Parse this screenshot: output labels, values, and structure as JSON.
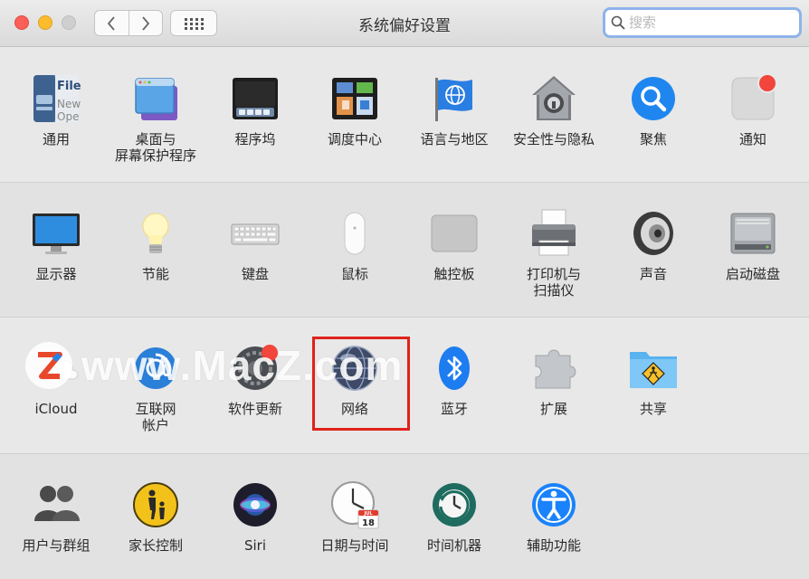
{
  "window": {
    "title": "系统偏好设置"
  },
  "search": {
    "placeholder": "搜索",
    "value": ""
  },
  "rows": [
    {
      "items": [
        {
          "label": "通用",
          "icon": "general-icon"
        },
        {
          "label": "桌面与\n屏幕保护程序",
          "icon": "desktop-screensaver-icon"
        },
        {
          "label": "程序坞",
          "icon": "dock-icon"
        },
        {
          "label": "调度中心",
          "icon": "mission-control-icon"
        },
        {
          "label": "语言与地区",
          "icon": "language-region-icon"
        },
        {
          "label": "安全性与隐私",
          "icon": "security-privacy-icon"
        },
        {
          "label": "聚焦",
          "icon": "spotlight-icon"
        },
        {
          "label": "通知",
          "icon": "notifications-icon"
        }
      ]
    },
    {
      "items": [
        {
          "label": "显示器",
          "icon": "displays-icon"
        },
        {
          "label": "节能",
          "icon": "energy-saver-icon"
        },
        {
          "label": "键盘",
          "icon": "keyboard-icon"
        },
        {
          "label": "鼠标",
          "icon": "mouse-icon"
        },
        {
          "label": "触控板",
          "icon": "trackpad-icon"
        },
        {
          "label": "打印机与\n扫描仪",
          "icon": "printers-scanners-icon"
        },
        {
          "label": "声音",
          "icon": "sound-icon"
        },
        {
          "label": "启动磁盘",
          "icon": "startup-disk-icon"
        }
      ]
    },
    {
      "items": [
        {
          "label": "iCloud",
          "icon": "icloud-icon"
        },
        {
          "label": "互联网\n帐户",
          "icon": "internet-accounts-icon"
        },
        {
          "label": "软件更新",
          "icon": "software-update-icon"
        },
        {
          "label": "网络",
          "icon": "network-icon"
        },
        {
          "label": "蓝牙",
          "icon": "bluetooth-icon"
        },
        {
          "label": "扩展",
          "icon": "extensions-icon"
        },
        {
          "label": "共享",
          "icon": "sharing-icon"
        }
      ]
    },
    {
      "items": [
        {
          "label": "用户与群组",
          "icon": "users-groups-icon"
        },
        {
          "label": "家长控制",
          "icon": "parental-controls-icon"
        },
        {
          "label": "Siri",
          "icon": "siri-icon"
        },
        {
          "label": "日期与时间",
          "icon": "date-time-icon"
        },
        {
          "label": "时间机器",
          "icon": "time-machine-icon"
        },
        {
          "label": "辅助功能",
          "icon": "accessibility-icon"
        }
      ]
    }
  ],
  "icon_text": {
    "general_file": "File",
    "general_new": "New",
    "general_ope": "Ope",
    "calendar_month": "JUL",
    "calendar_day": "18"
  },
  "watermark": {
    "text": "www.MacZ.com",
    "logo_letter": "Z"
  },
  "colors": {
    "highlight_border": "#e0221c",
    "search_focus": "#8fb3ea",
    "accent_blue": "#1a82fb",
    "notification_badge": "#f2453b"
  }
}
